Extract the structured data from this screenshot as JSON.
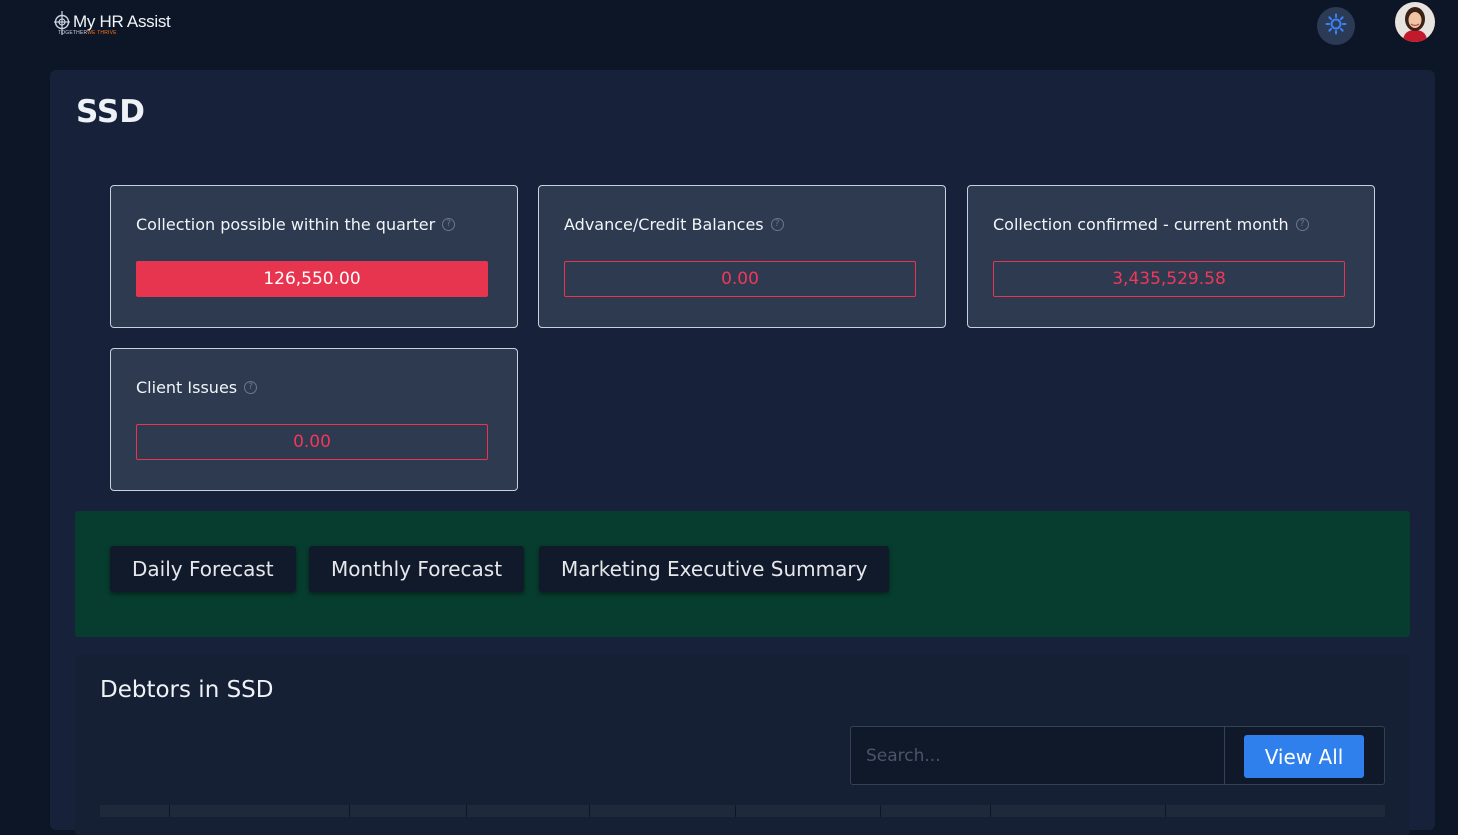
{
  "brand": {
    "name": "My HR Assist",
    "tagline_prefix": "TOGETHER",
    "tagline_accent": "WE THRIVE"
  },
  "header": {
    "theme_icon": "sun-icon",
    "avatar_icon": "user-avatar"
  },
  "page": {
    "title": "SSD"
  },
  "kpis": [
    {
      "label": "Collection possible within the quarter",
      "value": "126,550.00",
      "filled": true
    },
    {
      "label": "Advance/Credit Balances",
      "value": "0.00",
      "filled": false
    },
    {
      "label": "Collection confirmed - current month",
      "value": "3,435,529.58",
      "filled": false
    },
    {
      "label": "Client Issues",
      "value": "0.00",
      "filled": false
    }
  ],
  "help_icon": "question-circle-icon",
  "forecast": {
    "buttons": [
      {
        "label": "Daily Forecast"
      },
      {
        "label": "Monthly Forecast"
      },
      {
        "label": "Marketing Executive Summary"
      }
    ]
  },
  "debtors": {
    "title": "Debtors in SSD",
    "search_placeholder": "Search...",
    "view_all_label": "View All"
  },
  "colors": {
    "accent_red": "#e8354f",
    "accent_blue": "#2f80ed",
    "forecast_bg": "#073d2e"
  }
}
